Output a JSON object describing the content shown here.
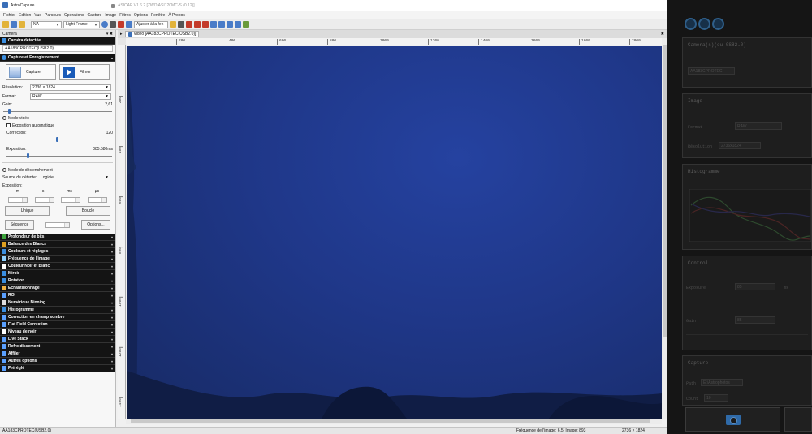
{
  "window": {
    "title": "AstroCapture"
  },
  "bg_window": {
    "title": "ASICAP V1.6.2 [ZWO ASI120MC-S (0.12)]",
    "menu": [
      "Fichier",
      "Edition",
      "Vue",
      "Parcours",
      "Opérations",
      "Capture",
      "Image",
      "Filtres",
      "Options",
      "Fenêtre",
      "À Propos"
    ],
    "camera_panel_title": "Camera(s)(ou 0S82.0)",
    "camera_value": "AA183CPROTEC",
    "image_title": "Image",
    "format_label": "Format",
    "format_value": "RAW",
    "resolution_label": "Résolution",
    "resolution_value": "2736x1824",
    "histogram_title": "Histogramme",
    "control_title": "Control",
    "exposure_label": "Exposure",
    "exposure_value": "85",
    "exposure_unit": "ms",
    "gain_label": "Gain",
    "gain_value": "85",
    "capture_title": "Capture",
    "path_label": "Path",
    "path_value": "E:\\Astrophotos",
    "count_label": "Count",
    "count_value": "10"
  },
  "toolbar": {
    "value_combo": "NA",
    "frame_combo": "Light Frame",
    "fit_button": "Ajuster à la fen",
    "colors": {
      "blue": "#4a7cc8",
      "yellow": "#e2b33a",
      "red": "#c43a2a",
      "green": "#6a9a3a"
    }
  },
  "camera_panel": {
    "title": "Caméra",
    "detected_header": "Caméra détectée",
    "camera_name": "AA183CPROTEC(USB2.0)",
    "capture_header": "Capture et Enregistrement",
    "capture_button": "Capturer",
    "film_button": "Filmer",
    "resolution_label": "Résolution:",
    "resolution_value": "2736 × 1824",
    "format_label": "Format:",
    "format_value": "RAW",
    "gain_label": "Gain:",
    "gain_value": "2,61",
    "gain_level": 0.05,
    "video_mode": "Mode vidéo",
    "auto_exposure": "Exposition automatique",
    "correction_label": "Correction:",
    "correction_value": "120",
    "correction_level": 0.48,
    "exposure_label": "Exposition:",
    "exposure_value": "085.580ms",
    "exposure_level": 0.2,
    "trigger_mode": "Mode de déclenchement",
    "trigger_source_label": "Source de détente:",
    "trigger_source_value": "Logiciel",
    "trigger_exposure_label": "Exposition:",
    "units": [
      "m",
      "s",
      "ms",
      "µs"
    ],
    "single_button": "Unique",
    "loop_button": "Boucle",
    "sequence_button": "Séquence",
    "options_button": "Options...",
    "sections": [
      {
        "label": "Profondeur de bits",
        "icon": "green-square-icon",
        "color": "#3ba23b"
      },
      {
        "label": "Balance des Blancs",
        "icon": "white-balance-icon",
        "color": "#e0a020"
      },
      {
        "label": "Couleurs et réglages",
        "icon": "colors-icon",
        "color": "#3a8ee0"
      },
      {
        "label": "Fréquence de l'image",
        "icon": "frequency-icon",
        "color": "#8fd0ff"
      },
      {
        "label": "Couleur/Noir et Blanc",
        "icon": "color-bw-icon",
        "color": "#ffffff"
      },
      {
        "label": "Miroir",
        "icon": "mirror-icon",
        "color": "#3a8ee0"
      },
      {
        "label": "Rotation",
        "icon": "rotation-icon",
        "color": "#3a8ee0"
      },
      {
        "label": "Echantillonnage",
        "icon": "sampling-icon",
        "color": "#f0b040"
      },
      {
        "label": "ROI",
        "icon": "roi-icon",
        "color": "#5aa0ff"
      },
      {
        "label": "Numérique Binning",
        "icon": "binning-icon",
        "color": "#dddddd"
      },
      {
        "label": "Histogramme",
        "icon": "histogram-icon",
        "color": "#3a8ee0"
      },
      {
        "label": "Correction en champ sombre",
        "icon": "dark-field-icon",
        "color": "#5aa0ff"
      },
      {
        "label": "Flat Field Correction",
        "icon": "flat-field-icon",
        "color": "#5aa0ff"
      },
      {
        "label": "Niveau de noir",
        "icon": "black-level-icon",
        "color": "#ffffff"
      },
      {
        "label": "Live Stack",
        "icon": "live-stack-icon",
        "color": "#5aa0ff"
      },
      {
        "label": "Refroidissement",
        "icon": "cooling-icon",
        "color": "#5aa0ff"
      },
      {
        "label": "Affiler",
        "icon": "sharpen-icon",
        "color": "#5aa0ff"
      },
      {
        "label": "Autres options",
        "icon": "options-icon",
        "color": "#5aa0ff"
      },
      {
        "label": "Préréglé",
        "icon": "preset-icon",
        "color": "#5aa0ff"
      }
    ]
  },
  "video": {
    "tab_label": "Vidéo [AA183CPROTEC(USB2.0)]",
    "ruler_top": [
      "200",
      "400",
      "600",
      "800",
      "1000",
      "1200",
      "1400",
      "1600",
      "1800",
      "2000"
    ],
    "ruler_left": [
      "200",
      "400",
      "600",
      "800",
      "1000",
      "1200",
      "1400"
    ],
    "sky_color": "#1d3278"
  },
  "status": {
    "camera": "AA183CPROTEC(USB2.0)",
    "frame_info": "Fréquence de l'image: 6.5; Image: 893",
    "resolution": "2736 × 1824"
  }
}
